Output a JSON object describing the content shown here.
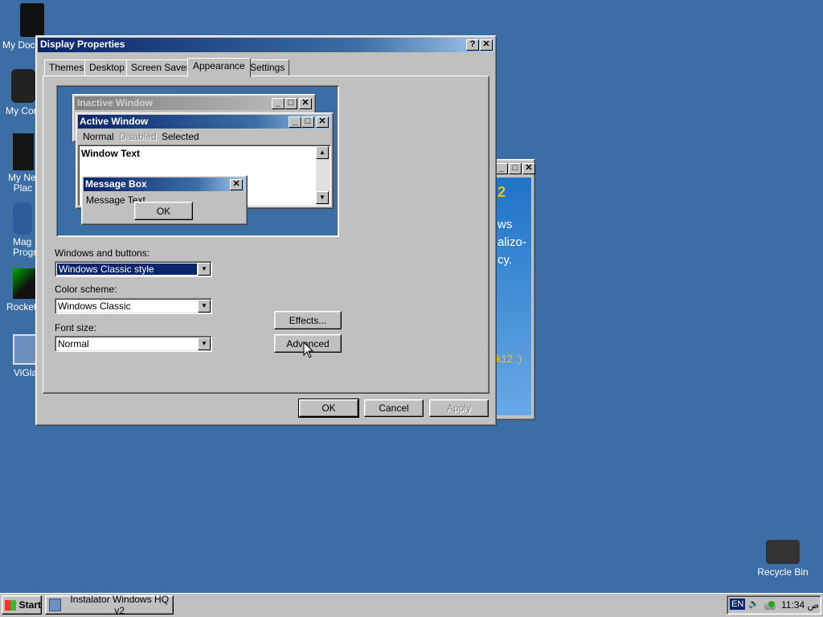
{
  "desktop": {
    "icons": [
      {
        "label": "My Docu",
        "name": "my-documents"
      },
      {
        "label": "My Com",
        "name": "my-computer"
      },
      {
        "label": "My Net‑ Plac",
        "name": "my-network-places"
      },
      {
        "label": "Mag Progra",
        "name": "magic-programs"
      },
      {
        "label": "Rocket",
        "name": "rocket"
      },
      {
        "label": "ViGlan",
        "name": "viglance"
      }
    ],
    "recycle_bin": "Recycle Bin",
    "background_window_text": [
      "ws",
      "alizo-",
      "cy.",
      "k12 :)"
    ]
  },
  "dialog": {
    "title": "Display Properties",
    "help_btn": "?",
    "close_btn": "✕",
    "tabs": [
      "Themes",
      "Desktop",
      "Screen Saver",
      "Appearance",
      "Settings"
    ],
    "active_tab": "Appearance",
    "preview": {
      "inactive_title": "Inactive Window",
      "active_title": "Active Window",
      "menu_normal": "Normal",
      "menu_disabled": "Disabled",
      "menu_selected": "Selected",
      "window_text": "Window Text",
      "msgbox_title": "Message Box",
      "msgbox_text": "Message Text",
      "msgbox_ok": "OK"
    },
    "windows_buttons_label": "Windows and buttons:",
    "windows_buttons_value": "Windows Classic style",
    "color_scheme_label": "Color scheme:",
    "color_scheme_value": "Windows Classic",
    "font_size_label": "Font size:",
    "font_size_value": "Normal",
    "effects_btn": "Effects...",
    "advanced_btn": "Advanced",
    "ok_btn": "OK",
    "cancel_btn": "Cancel",
    "apply_btn": "Apply"
  },
  "taskbar": {
    "start": "Start",
    "task": "Instalator Windows HQ v2",
    "lang": "EN",
    "clock": "11:34 ص"
  },
  "colors": {
    "desktop": "#3a6ea5",
    "active_title": "#0a246a",
    "inactive_title": "#808080"
  }
}
